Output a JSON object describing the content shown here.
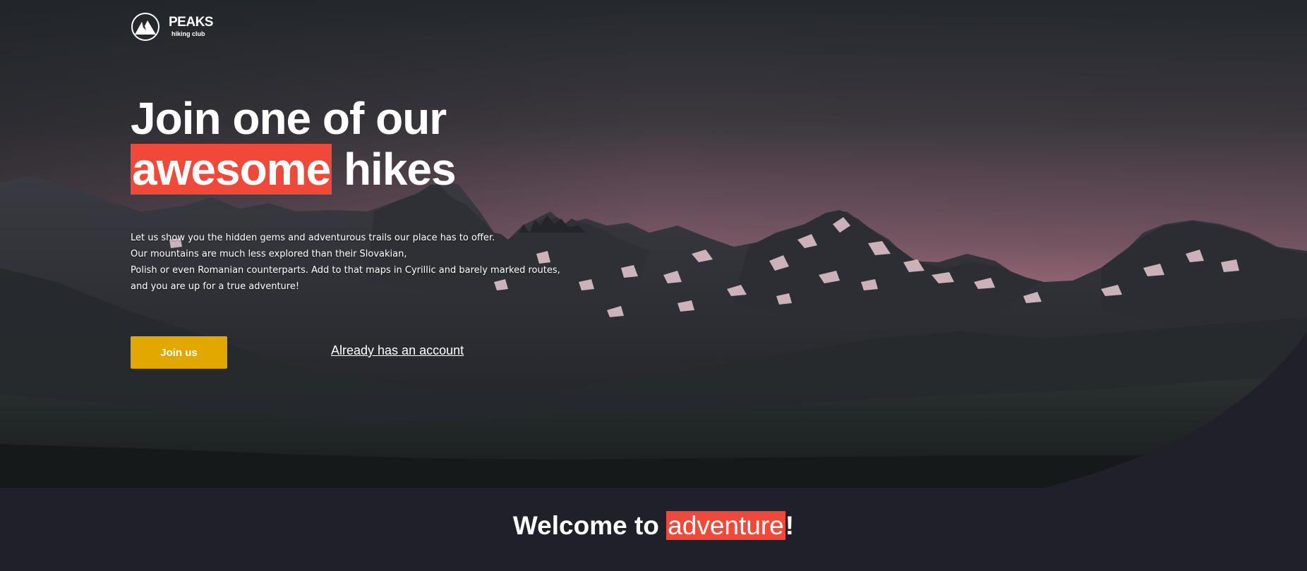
{
  "brand": {
    "name": "PEAKS",
    "tagline": "hiking club",
    "logo_icon": "mountain-logo-icon"
  },
  "hero": {
    "headline_line1": "Join one of our",
    "headline_highlight": "awesome",
    "headline_line2_rest": "hikes",
    "intro_lines": [
      "Let us show you the hidden gems and adventurous trails our place has to offer.",
      "Our mountains are much less explored than their Slovakian,",
      "Polish or even Romanian counterparts. Add to that maps in Cyrillic and barely marked routes,",
      "and you are up for a true adventure!"
    ],
    "join_button_label": "Join us",
    "account_link_label": "Already has an account"
  },
  "welcome": {
    "prefix": "Welcome to",
    "highlight": "adventure",
    "suffix": "!"
  },
  "colors": {
    "accent_red": "#f0493a",
    "button_yellow": "#e2a800",
    "section_background": "#20202b",
    "sky_pink": "#a6707f"
  }
}
